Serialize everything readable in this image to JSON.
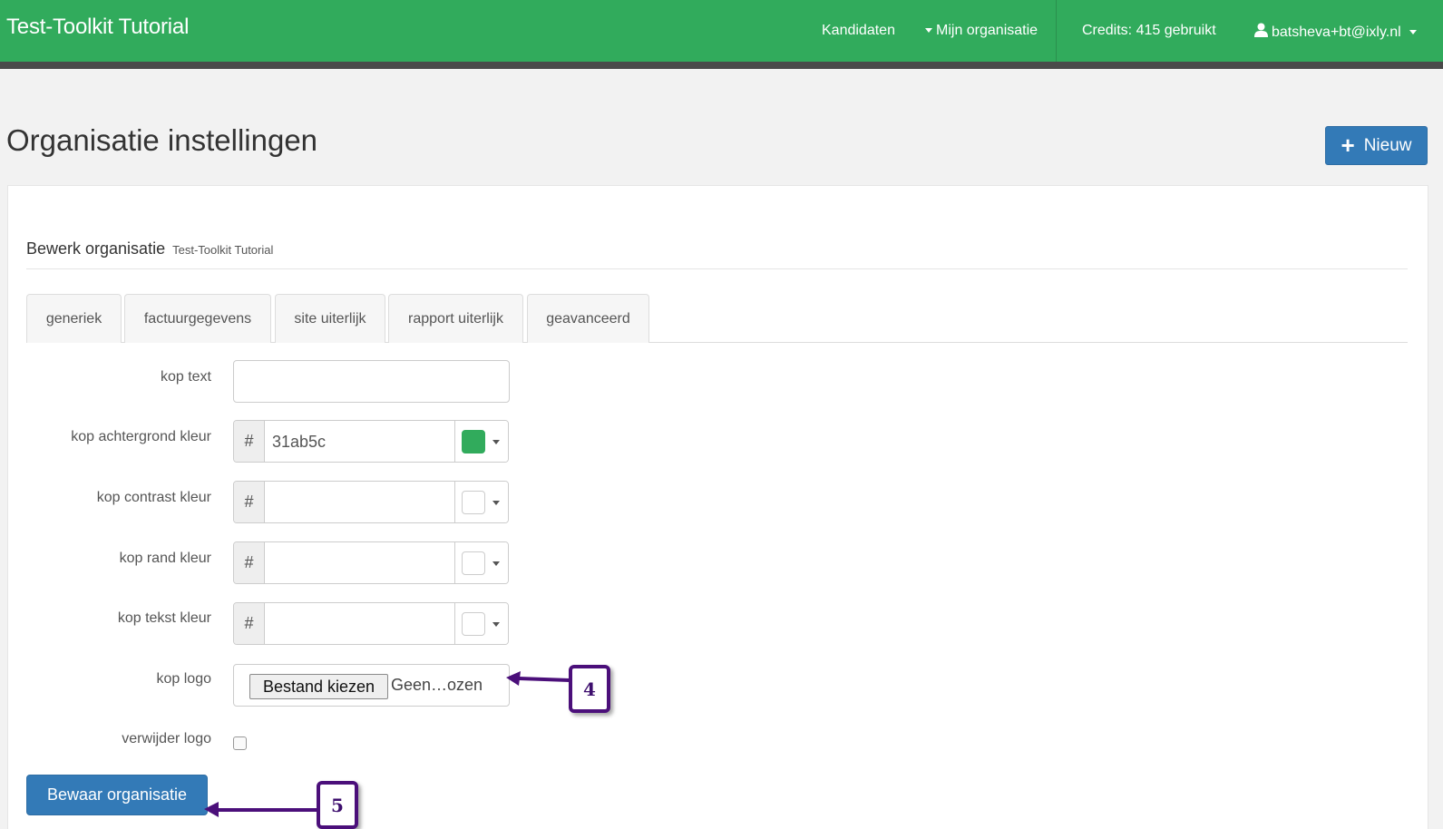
{
  "navbar": {
    "brand": "Test-Toolkit Tutorial",
    "links": {
      "kandidaten": "Kandidaten",
      "organisatie": "Mijn organisatie",
      "credits": "Credits: 415 gebruikt",
      "user": "batsheva+bt@ixly.nl"
    },
    "color": "#31ab5c"
  },
  "page": {
    "title": "Organisatie instellingen",
    "new_button": "Nieuw"
  },
  "panel": {
    "heading": "Bewerk organisatie",
    "subheading": "Test-Toolkit Tutorial",
    "tabs": [
      "generiek",
      "factuurgegevens",
      "site uiterlijk",
      "rapport uiterlijk",
      "geavanceerd"
    ]
  },
  "form": {
    "kop_text": {
      "label": "kop text",
      "value": ""
    },
    "kop_achtergrond_kleur": {
      "label": "kop achtergrond kleur",
      "prefix": "#",
      "value": "31ab5c",
      "swatch": "#31ab5c"
    },
    "kop_contrast_kleur": {
      "label": "kop contrast kleur",
      "prefix": "#",
      "value": ""
    },
    "kop_rand_kleur": {
      "label": "kop rand kleur",
      "prefix": "#",
      "value": ""
    },
    "kop_tekst_kleur": {
      "label": "kop tekst kleur",
      "prefix": "#",
      "value": ""
    },
    "kop_logo": {
      "label": "kop logo",
      "button": "Bestand kiezen",
      "status": "Geen…ozen"
    },
    "verwijder_logo": {
      "label": "verwijder logo",
      "checked": false
    },
    "save_button": "Bewaar organisatie"
  },
  "callouts": [
    "4",
    "5"
  ]
}
